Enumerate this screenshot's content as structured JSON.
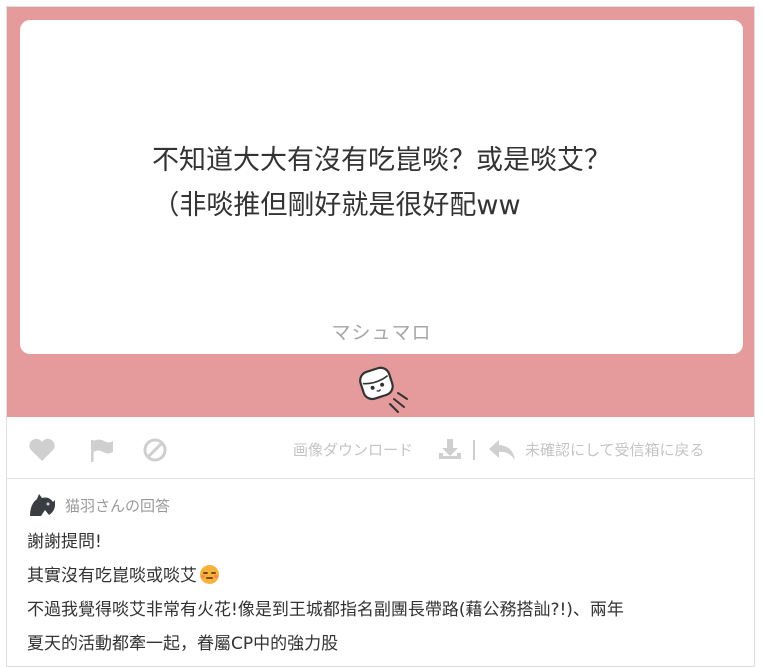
{
  "question": {
    "line1": "不知道大大有沒有吃崑啖？或是啖艾？",
    "line2": "（非啖推但剛好就是很好配ww",
    "brand": "マシュマロ"
  },
  "actions": {
    "like_icon": "heart-icon",
    "report_icon": "flag-icon",
    "block_icon": "ban-icon",
    "download_label": "画像ダウンロード",
    "download_icon": "download-icon",
    "back_label": "未確認にして受信箱に戻る",
    "back_icon": "reply-arrow-icon"
  },
  "answer": {
    "author_label": "猫羽さんの回答",
    "lines": [
      "謝謝提問!",
      "其實沒有吃崑啖或啖艾",
      "不過我覺得啖艾非常有火花!像是到王城都指名副團長帶路(藉公務搭訕?!)、兩年",
      "夏天的活動都牽一起，眷屬CP中的強力股"
    ],
    "emoji": "pensive-face-emoji"
  },
  "colors": {
    "panel": "#e59a9c",
    "card": "#ffffff",
    "muted_text": "#c4c4c4"
  }
}
